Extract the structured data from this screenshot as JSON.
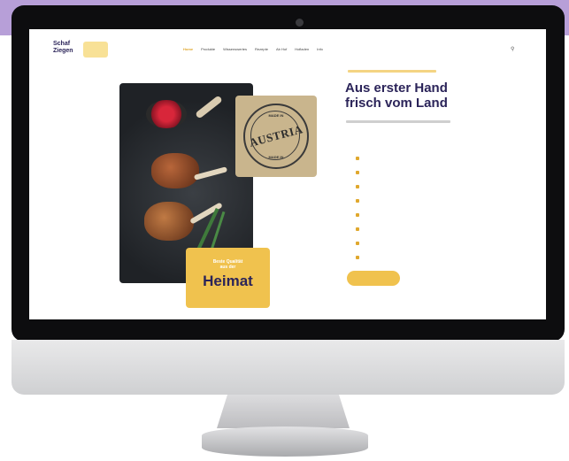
{
  "site": {
    "logo_text": "Schaf\nZiegen",
    "nav": [
      "Home",
      "Produkte",
      "Wissenswertes",
      "Rezepte",
      "Ab Hof",
      "Hofladen",
      "Info"
    ],
    "active_nav_index": 0
  },
  "hero": {
    "stamp_word": "AUSTRIA",
    "stamp_top": "MADE IN",
    "stamp_bottom": "MADE IN",
    "card_small": "Beste Qualität\naus der",
    "card_big": "Heimat",
    "headline_line1": "Aus erster Hand",
    "headline_line2": "frisch vom Land",
    "features": [
      "",
      "",
      "",
      "",
      "",
      "",
      "",
      ""
    ],
    "cta_label": ""
  },
  "colors": {
    "brand_navy": "#2b2459",
    "accent_yellow": "#f0c24e",
    "background_band": "#b79fd8"
  }
}
